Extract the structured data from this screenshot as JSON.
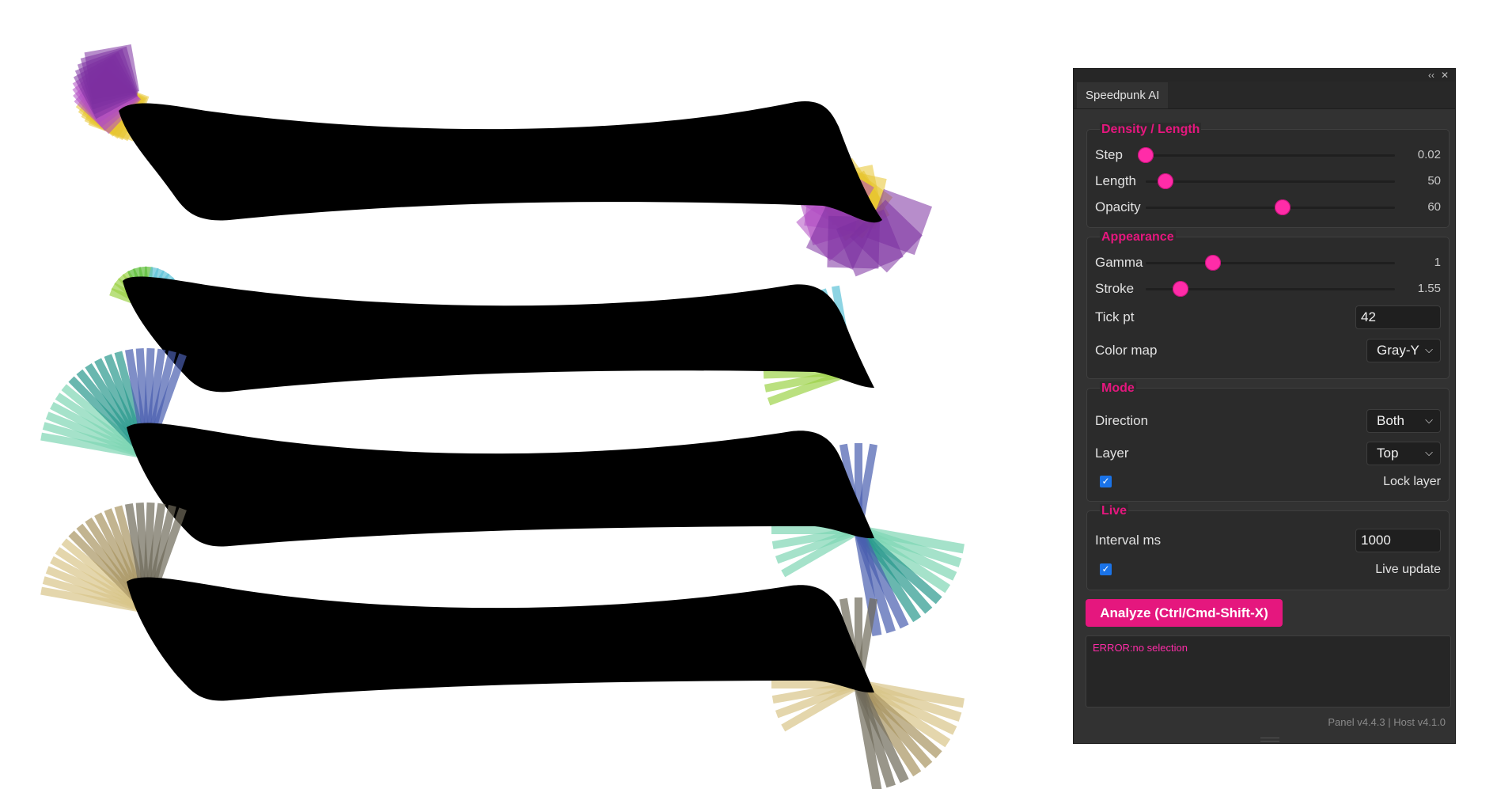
{
  "panel": {
    "tab_title": "Speedpunk AI",
    "title_controls": {
      "collapse": "‹‹",
      "close": "✕"
    },
    "groups": {
      "density": {
        "title": "Density / Length",
        "sliders": [
          {
            "label": "Step",
            "value": "0.02",
            "level": 0.0
          },
          {
            "label": "Length",
            "value": "50",
            "level": 0.08
          },
          {
            "label": "Opacity",
            "value": "60",
            "level": 0.55
          }
        ]
      },
      "appearance": {
        "title": "Appearance",
        "sliders": [
          {
            "label": "Gamma",
            "value": "1",
            "level": 0.27
          },
          {
            "label": "Stroke",
            "value": "1.55",
            "level": 0.14
          }
        ],
        "tick_pt": {
          "label": "Tick pt",
          "value": "42"
        },
        "color_map": {
          "label": "Color map",
          "value": "Gray-Y"
        }
      },
      "mode": {
        "title": "Mode",
        "direction": {
          "label": "Direction",
          "value": "Both"
        },
        "layer": {
          "label": "Layer",
          "value": "Top"
        },
        "lock_layer": {
          "label": "Lock layer",
          "checked": true
        }
      },
      "live": {
        "title": "Live",
        "interval": {
          "label": "Interval ms",
          "value": "1000"
        },
        "live_update": {
          "label": "Live update",
          "checked": true
        }
      }
    },
    "analyze_button": "Analyze (Ctrl/Cmd-Shift-X)",
    "log_text": "ERROR:no selection",
    "footer": "Panel v4.4.3 | Host v4.1.0"
  },
  "canvas": {
    "shapes": [
      {
        "name": "purple-yellow",
        "colors": [
          "#e8c52e",
          "#b04cc2",
          "#7b2fa0"
        ]
      },
      {
        "name": "green",
        "colors": [
          "#9ed34a",
          "#5fbf3a",
          "#5ec3d8"
        ]
      },
      {
        "name": "teal",
        "colors": [
          "#7fd7b5",
          "#2a9a8e",
          "#4a5fb0"
        ]
      },
      {
        "name": "tan",
        "colors": [
          "#d9c68a",
          "#a99562",
          "#6f6a5a"
        ]
      }
    ],
    "colors": {
      "shape_fill": "#000000",
      "accent": "#e5177e"
    }
  }
}
